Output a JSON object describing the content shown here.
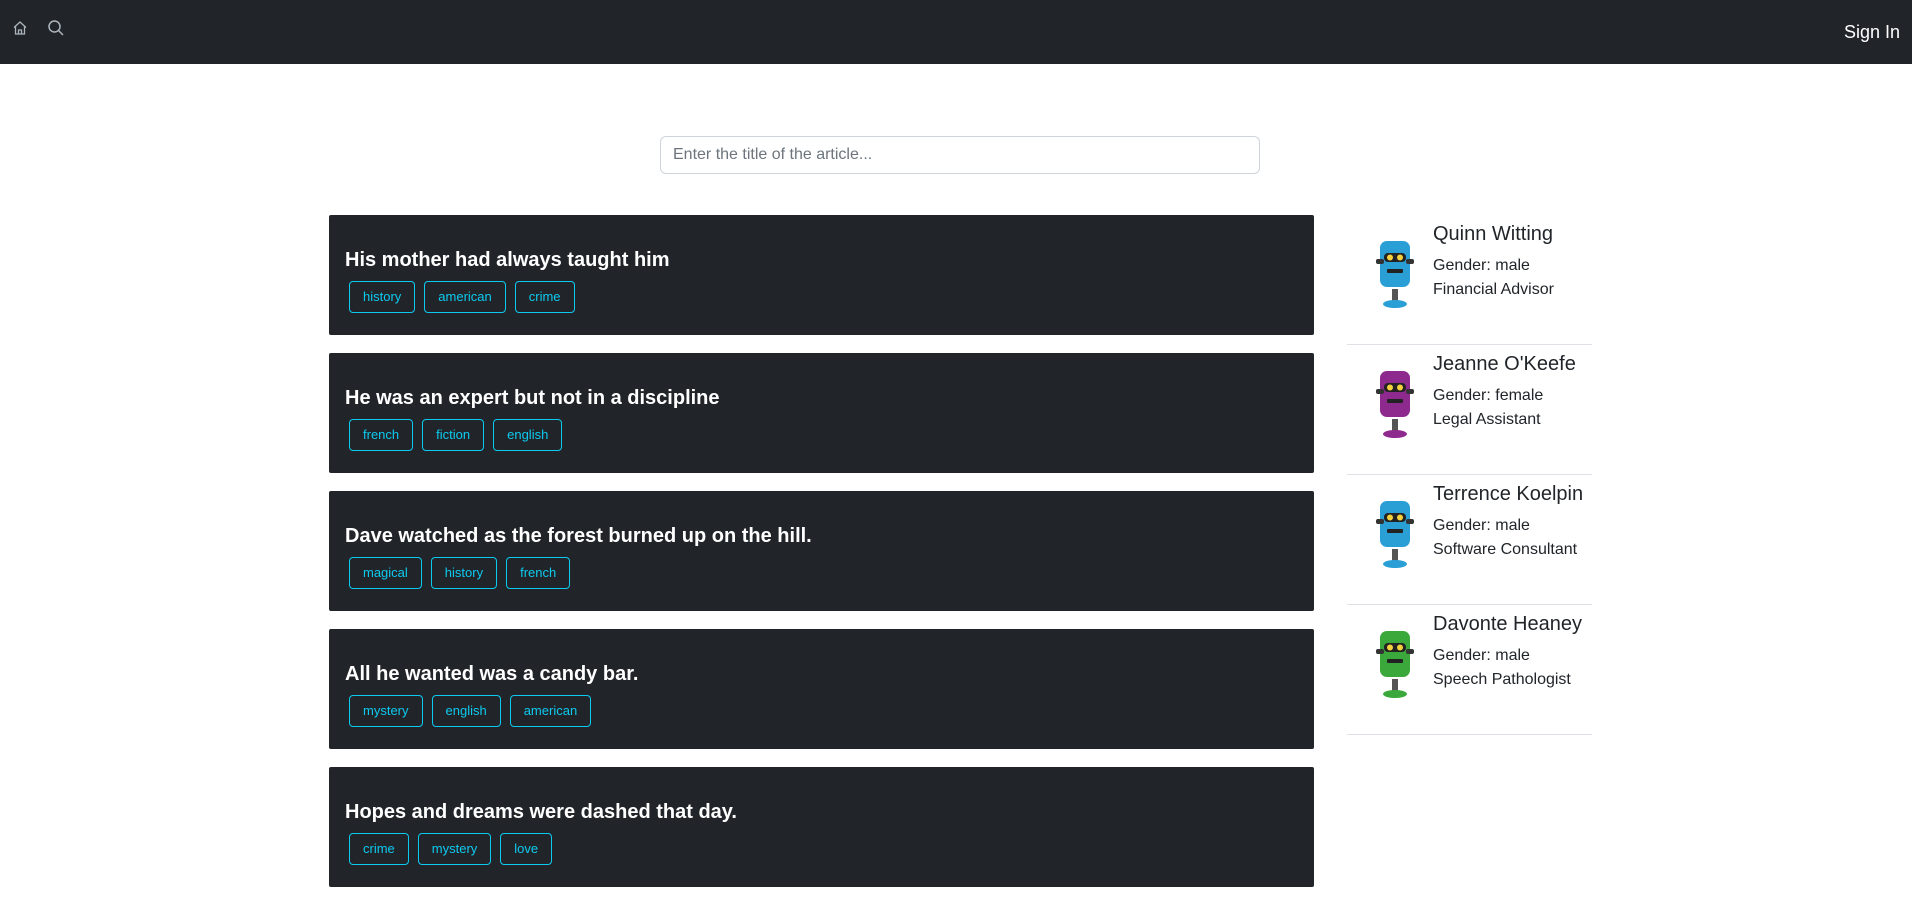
{
  "nav": {
    "home_icon": "home-icon",
    "search_icon": "search-icon",
    "signin_label": "Sign In"
  },
  "search": {
    "placeholder": "Enter the title of the article...",
    "value": ""
  },
  "colors": {
    "navbar": "#212529",
    "card": "#212529",
    "tag": "#0dcaf0"
  },
  "articles": [
    {
      "title": "His mother had always taught him",
      "tags": [
        "history",
        "american",
        "crime"
      ]
    },
    {
      "title": "He was an expert but not in a discipline",
      "tags": [
        "french",
        "fiction",
        "english"
      ]
    },
    {
      "title": "Dave watched as the forest burned up on the hill.",
      "tags": [
        "magical",
        "history",
        "french"
      ]
    },
    {
      "title": "All he wanted was a candy bar.",
      "tags": [
        "mystery",
        "english",
        "american"
      ]
    },
    {
      "title": "Hopes and dreams were dashed that day.",
      "tags": [
        "crime",
        "mystery",
        "love"
      ]
    }
  ],
  "users": [
    {
      "name": "Quinn Witting",
      "gender": "Gender: male",
      "job": "Financial Advisor",
      "avatar": "robot-avatar-blue",
      "avatar_color": "#2a9fd6"
    },
    {
      "name": "Jeanne O'Keefe",
      "gender": "Gender: female",
      "job": "Legal Assistant",
      "avatar": "robot-avatar-purple",
      "avatar_color": "#8e2a8e"
    },
    {
      "name": "Terrence Koelpin",
      "gender": "Gender: male",
      "job": "Software Consultant",
      "avatar": "robot-avatar-blue",
      "avatar_color": "#2a9fd6"
    },
    {
      "name": "Davonte Heaney",
      "gender": "Gender: male",
      "job": "Speech Pathologist",
      "avatar": "robot-avatar-green",
      "avatar_color": "#3aa83a"
    }
  ]
}
